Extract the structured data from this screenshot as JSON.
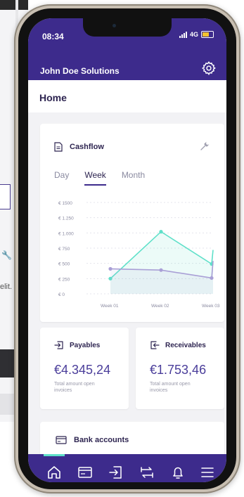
{
  "status": {
    "time": "08:34",
    "network": "4G"
  },
  "header": {
    "title": "John Doe Solutions",
    "settings_icon": "gear-icon"
  },
  "page": {
    "title": "Home"
  },
  "background": {
    "text_fragment": "elit."
  },
  "cashflow": {
    "title": "Cashflow",
    "tabs": [
      {
        "label": "Day",
        "active": false
      },
      {
        "label": "Week",
        "active": true
      },
      {
        "label": "Month",
        "active": false
      }
    ]
  },
  "payables": {
    "title": "Payables",
    "amount": "€4.345,24",
    "description": "Total amount open invoices"
  },
  "receivables": {
    "title": "Receivables",
    "amount": "€1.753,46",
    "description": "Total amount open invoices"
  },
  "bank": {
    "title": "Bank accounts"
  },
  "nav": {
    "items": [
      "home-icon",
      "invoices-icon",
      "import-icon",
      "transfer-icon",
      "bell-icon",
      "menu-icon"
    ],
    "active_index": 0
  },
  "colors": {
    "brand": "#3d2b8c",
    "teal": "#5fe0c9",
    "lavender": "#a99fd6"
  },
  "chart_data": {
    "type": "line",
    "categories": [
      "Week 01",
      "Week 02",
      "Week 03"
    ],
    "y_ticks": [
      "€ 0",
      "€ 250",
      "€ 500",
      "€ 750",
      "€ 1.000",
      "€ 1.250",
      "€ 1500"
    ],
    "ylim": [
      0,
      1500
    ],
    "series": [
      {
        "color": "#5fe0c9",
        "values": [
          250,
          1020,
          490
        ],
        "trailing_value": 720
      },
      {
        "color": "#a99fd6",
        "values": [
          410,
          390,
          260
        ],
        "trailing_value": 540
      }
    ],
    "grid": true
  }
}
